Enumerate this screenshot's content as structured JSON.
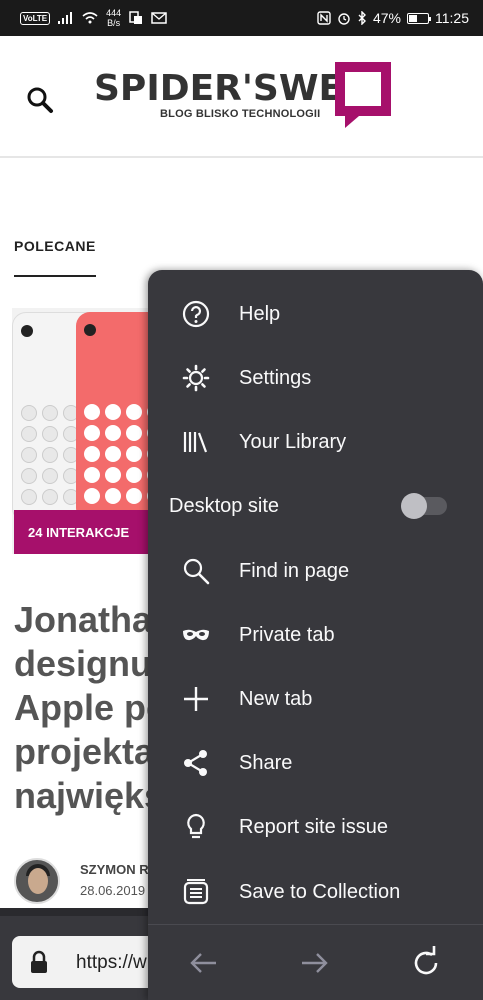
{
  "status_bar": {
    "volte": "VoLTE",
    "net_speed_value": "444",
    "net_speed_unit": "B/s",
    "battery_percent": "47%",
    "battery_level": 0.47,
    "time": "11:25"
  },
  "site": {
    "logo_text": "SPIDER'SWEB",
    "logo_tagline": "BLOG BLISKO TECHNOLOGII",
    "brand_color": "#a6106b",
    "section_label": "POLECANE",
    "article": {
      "badge": "24 INTERAKCJE",
      "headline_lines": [
        "Jonatha",
        "designu.",
        "Apple po",
        "projekta",
        "największ"
      ],
      "author": "SZYMON R",
      "date": "28.06.2019"
    }
  },
  "url_bar": {
    "url_text": "https://w"
  },
  "menu": {
    "items": [
      {
        "label": "Help",
        "icon": "help-circle-icon"
      },
      {
        "label": "Settings",
        "icon": "gear-icon"
      },
      {
        "label": "Your Library",
        "icon": "library-icon"
      },
      {
        "label": "Desktop site",
        "icon": "",
        "toggle": false
      },
      {
        "label": "Find in page",
        "icon": "search-icon"
      },
      {
        "label": "Private tab",
        "icon": "mask-icon"
      },
      {
        "label": "New tab",
        "icon": "plus-icon"
      },
      {
        "label": "Share",
        "icon": "share-icon"
      },
      {
        "label": "Report site issue",
        "icon": "lightbulb-icon"
      },
      {
        "label": "Save to Collection",
        "icon": "collection-icon"
      }
    ],
    "nav": [
      "back-arrow-icon",
      "forward-arrow-icon",
      "reload-icon"
    ]
  }
}
